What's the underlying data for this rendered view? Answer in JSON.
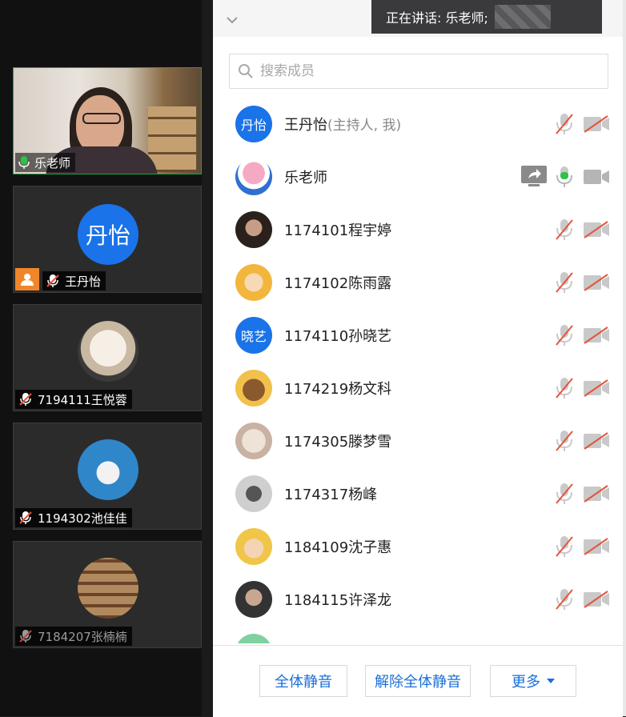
{
  "speaker_banner": {
    "label": "正在讲话: 乐老师;"
  },
  "search": {
    "placeholder": "搜索成员"
  },
  "video_tiles": [
    {
      "name": "乐老师",
      "mic": "on"
    },
    {
      "avatar_text": "丹怡",
      "name": "王丹怡",
      "mic": "muted",
      "host": true
    },
    {
      "name": "7194111王悦蓉",
      "mic": "muted"
    },
    {
      "name": "1194302池佳佳",
      "mic": "muted"
    },
    {
      "name": "7184207张楠楠",
      "mic": "muted"
    }
  ],
  "members": [
    {
      "name": "王丹怡",
      "role": "(主持人, 我)",
      "avatar_text": "丹怡",
      "avatar_color": "#1a73e8",
      "mic": "muted",
      "cam": "off"
    },
    {
      "name": "乐老师",
      "role": "",
      "avatar_text": "",
      "mic": "speaking",
      "cam": "on",
      "sharing": true
    },
    {
      "name": "1174101程宇婷",
      "role": "",
      "mic": "muted",
      "cam": "off"
    },
    {
      "name": "1174102陈雨露",
      "role": "",
      "mic": "muted",
      "cam": "off"
    },
    {
      "name": "1174110孙晓艺",
      "role": "",
      "avatar_text": "晓艺",
      "avatar_color": "#1a73e8",
      "mic": "muted",
      "cam": "off"
    },
    {
      "name": "1174219杨文科",
      "role": "",
      "mic": "muted",
      "cam": "off"
    },
    {
      "name": "1174305滕梦雪",
      "role": "",
      "mic": "muted",
      "cam": "off"
    },
    {
      "name": "1174317杨峰",
      "role": "",
      "mic": "muted",
      "cam": "off"
    },
    {
      "name": "1184109沈子惠",
      "role": "",
      "mic": "muted",
      "cam": "off"
    },
    {
      "name": "1184115许泽龙",
      "role": "",
      "mic": "muted",
      "cam": "off"
    }
  ],
  "footer": {
    "mute_all": "全体静音",
    "unmute_all": "解除全体静音",
    "more": "更多"
  },
  "colors": {
    "accent": "#1a6fd8",
    "muted_red": "#e5533d",
    "speaking_green": "#2fc14a",
    "active_border": "#19a34b"
  }
}
